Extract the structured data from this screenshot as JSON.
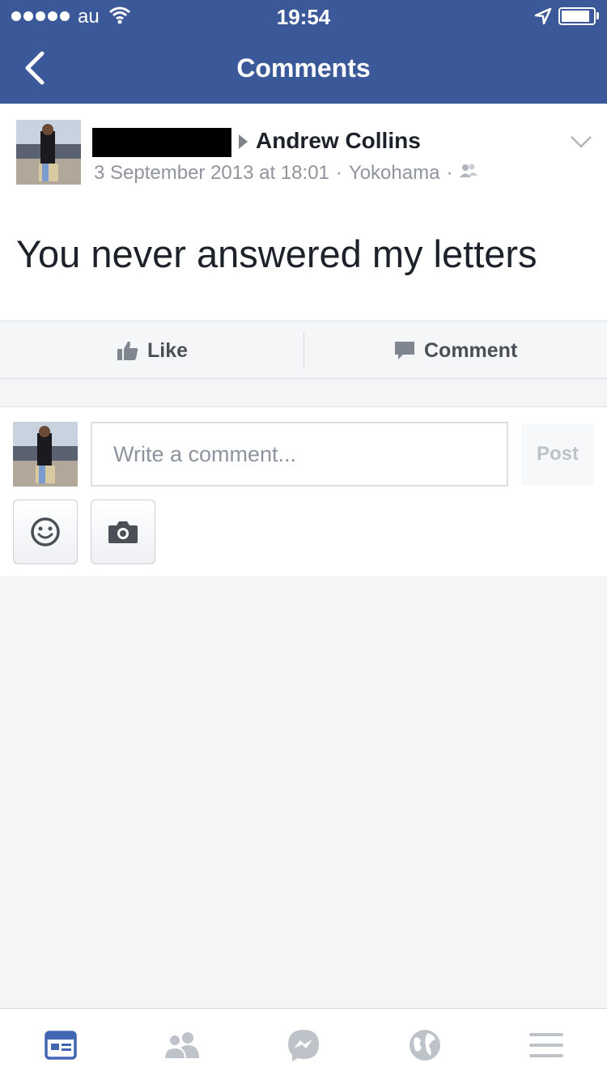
{
  "status_bar": {
    "carrier": "au",
    "time": "19:54",
    "signal_bars": 5,
    "battery_level": 0.9
  },
  "nav": {
    "title": "Comments",
    "back_icon": "chevron-left-icon"
  },
  "post": {
    "author": "Andrew Collins",
    "date": "3 September 2013 at 18:01",
    "separator": "·",
    "location": "Yokohama",
    "audience_icon": "friends-icon",
    "message": "You never answered my letters"
  },
  "actions": {
    "like_label": "Like",
    "comment_label": "Comment"
  },
  "composer": {
    "placeholder": "Write a comment...",
    "post_label": "Post"
  },
  "tabbar": {
    "items": [
      "news-feed-icon",
      "friends-icon",
      "messenger-icon",
      "globe-icon",
      "menu-icon"
    ],
    "active": "news-feed-icon"
  },
  "colors": {
    "brand": "#3b5998",
    "active_tab": "#4267b2",
    "inactive_tab": "#bec3c9",
    "text_muted": "#90949c"
  }
}
